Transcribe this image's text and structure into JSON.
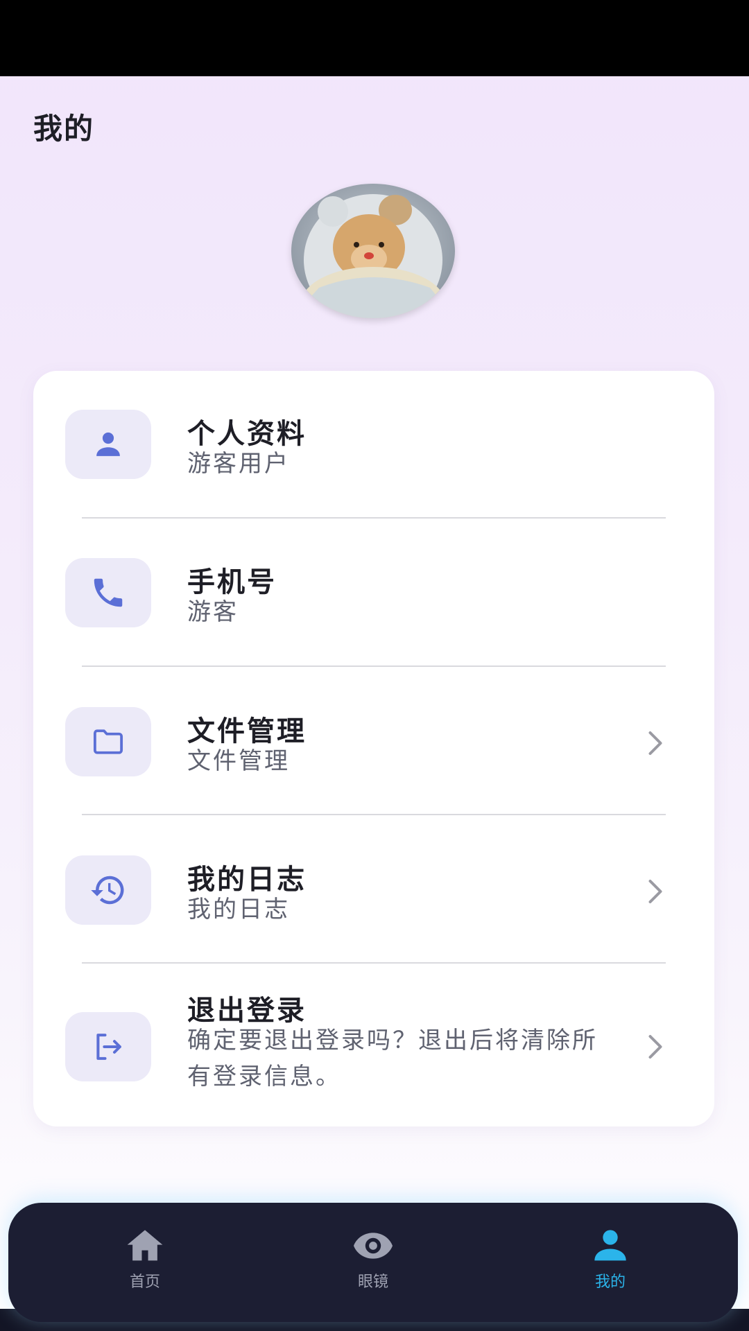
{
  "page": {
    "title": "我的"
  },
  "menu": [
    {
      "title": "个人资料",
      "subtitle": "游客用户",
      "icon": "person-icon",
      "has_chevron": false
    },
    {
      "title": "手机号",
      "subtitle": "游客",
      "icon": "phone-icon",
      "has_chevron": false
    },
    {
      "title": "文件管理",
      "subtitle": "文件管理",
      "icon": "folder-icon",
      "has_chevron": true
    },
    {
      "title": "我的日志",
      "subtitle": "我的日志",
      "icon": "history-icon",
      "has_chevron": true
    },
    {
      "title": "退出登录",
      "subtitle": "确定要退出登录吗？退出后将清除所有登录信息。",
      "icon": "logout-icon",
      "has_chevron": true
    }
  ],
  "nav": [
    {
      "label": "首页",
      "icon": "home-icon",
      "active": false
    },
    {
      "label": "眼镜",
      "icon": "eye-icon",
      "active": false
    },
    {
      "label": "我的",
      "icon": "person-icon",
      "active": true
    }
  ],
  "colors": {
    "accent": "#5b6fd6",
    "icon_bg": "#eceaf8",
    "nav_bg": "#1c1e33",
    "nav_active": "#2bb4ea",
    "nav_inactive": "#9fa2b2"
  }
}
